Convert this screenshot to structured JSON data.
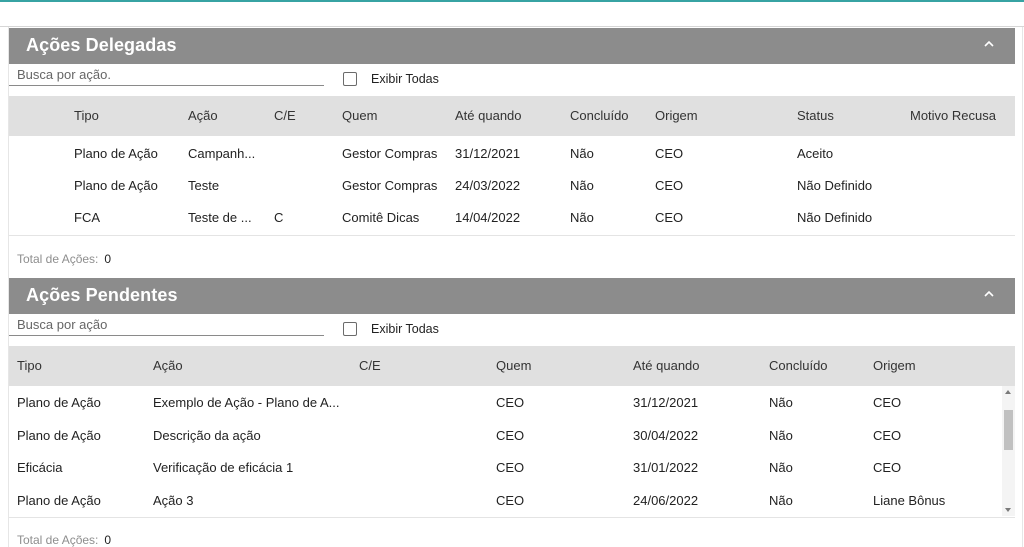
{
  "colors": {
    "header_bg": "#8c8c8c",
    "table_header_bg": "#e0e0e0",
    "accent": "#37a3a3"
  },
  "delegadas": {
    "title": "Ações Delegadas",
    "search_placeholder": "Busca por ação.",
    "show_all_label": "Exibir Todas",
    "columns": [
      "Tipo",
      "Ação",
      "C/E",
      "Quem",
      "Até quando",
      "Concluído",
      "Origem",
      "Status",
      "Motivo Recusa"
    ],
    "rows": [
      [
        "Plano de Ação",
        "Campanh...",
        "",
        "Gestor Compras",
        "31/12/2021",
        "Não",
        "CEO",
        "Aceito",
        ""
      ],
      [
        "Plano de Ação",
        "Teste",
        "",
        "Gestor Compras",
        "24/03/2022",
        "Não",
        "CEO",
        "Não Definido",
        ""
      ],
      [
        "FCA",
        "Teste de ...",
        "C",
        "Comitê Dicas",
        "14/04/2022",
        "Não",
        "CEO",
        "Não Definido",
        ""
      ]
    ],
    "total_label": "Total de Ações:",
    "total_value": "0"
  },
  "pendentes": {
    "title": "Ações Pendentes",
    "search_placeholder": "Busca por ação",
    "show_all_label": "Exibir Todas",
    "columns": [
      "Tipo",
      "Ação",
      "C/E",
      "Quem",
      "Até quando",
      "Concluído",
      "Origem"
    ],
    "rows": [
      [
        "Plano de Ação",
        "Exemplo de Ação - Plano de A...",
        "",
        "CEO",
        "31/12/2021",
        "Não",
        "CEO"
      ],
      [
        "Plano de Ação",
        "Descrição da ação",
        "",
        "CEO",
        "30/04/2022",
        "Não",
        "CEO"
      ],
      [
        "Eficácia",
        "Verificação de eficácia 1",
        "",
        "CEO",
        "31/01/2022",
        "Não",
        "CEO"
      ],
      [
        "Plano de Ação",
        "Ação 3",
        "",
        "CEO",
        "24/06/2022",
        "Não",
        "Liane Bônus"
      ]
    ],
    "total_label": "Total de Ações:",
    "total_value": "0"
  },
  "icons": {
    "collapse": "chevron-up-icon"
  }
}
